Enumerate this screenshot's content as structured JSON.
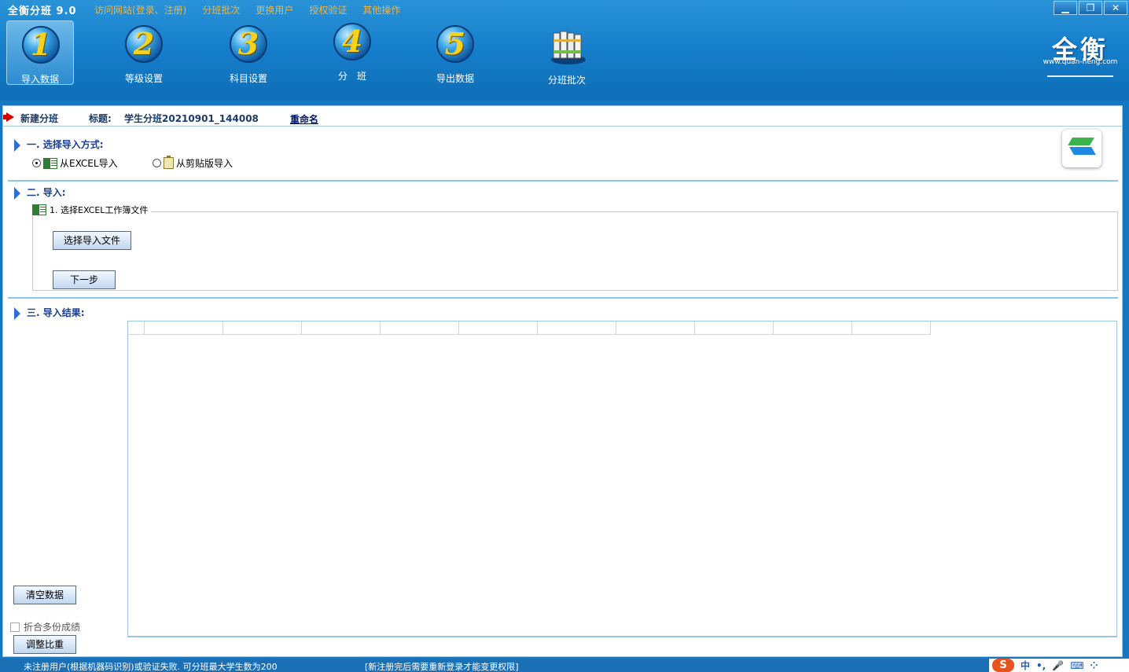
{
  "app": {
    "title": "全衡分班 9.0"
  },
  "menu": [
    "访问网站(登录、注册)",
    "分班批次",
    "更换用户",
    "授权验证",
    "其他操作"
  ],
  "window_controls": {
    "minimize": "▁",
    "restore": "❐",
    "close": "✕"
  },
  "toolbar": [
    {
      "number": "1",
      "label": "导入数据",
      "active": true
    },
    {
      "number": "2",
      "label": "等级设置"
    },
    {
      "number": "3",
      "label": "科目设置"
    },
    {
      "number": "4",
      "label": "分　班"
    },
    {
      "number": "5",
      "label": "导出数据"
    },
    {
      "number": "",
      "label": "分班批次",
      "icon": "books-icon"
    }
  ],
  "logo": {
    "text": "全衡",
    "url": "www.quan-heng.com"
  },
  "titlebar": {
    "new_label": "新建分班",
    "title_label": "标题:",
    "title_value": "学生分班20210901_144008",
    "rename": "重命名"
  },
  "section1": {
    "heading": "一. 选择导入方式:",
    "option_excel": "从EXCEL导入",
    "option_clipboard": "从剪贴版导入",
    "selected": "excel"
  },
  "section2": {
    "heading": "二. 导入:",
    "group_title": "1. 选择EXCEL工作簿文件",
    "select_file_button": "选择导入文件",
    "next_button": "下一步"
  },
  "section3": {
    "heading": "三. 导入结果:",
    "clear_button": "清空数据",
    "merge_checkbox": "折合多份成绩",
    "merge_checked": false,
    "adjust_button": "调整比重"
  },
  "status": {
    "left": "未注册用户(根据机器码识别)或验证失败. 可分班最大学生数为200",
    "middle": "[新注册完后需要重新登录才能变更权限]"
  },
  "ime": {
    "lang": "中",
    "punct": "•,",
    "mic": "🎤",
    "keyboard": "⌨",
    "menu": "⁘"
  },
  "colors": {
    "header": "#1680cc",
    "menu_text": "#f3b23c",
    "ball_number": "#f6d21a",
    "status": "#1a6fb5"
  }
}
